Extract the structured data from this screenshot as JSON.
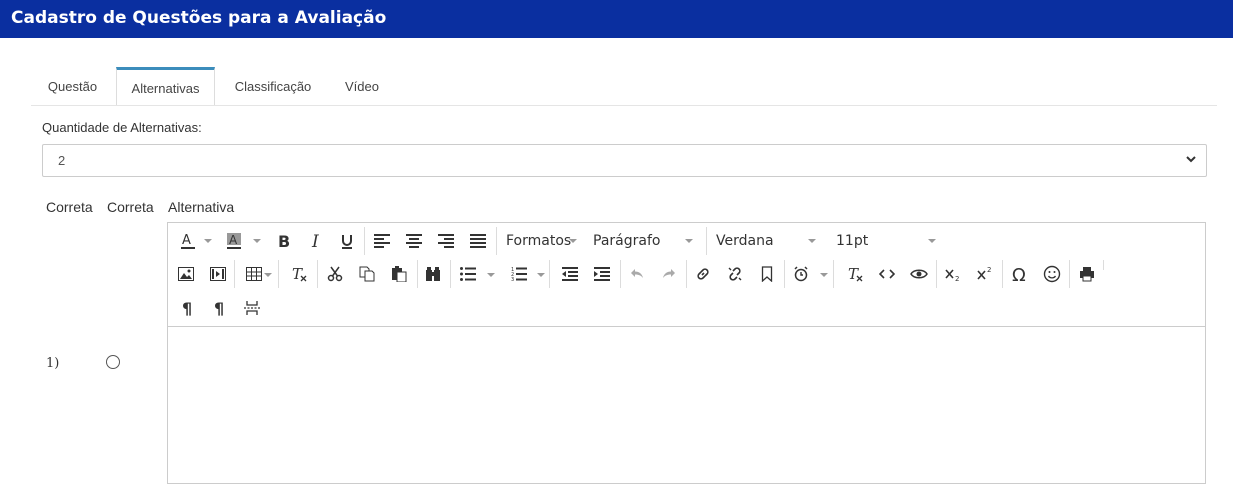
{
  "header": {
    "title": "Cadastro de Questões para a Avaliação"
  },
  "tabs": [
    {
      "label": "Questão",
      "active": false
    },
    {
      "label": "Alternativas",
      "active": true
    },
    {
      "label": "Classificação",
      "active": false
    },
    {
      "label": "Vídeo",
      "active": false
    }
  ],
  "quantity": {
    "label": "Quantidade de Alternativas:",
    "value": "2"
  },
  "columns": {
    "correta1": "Correta",
    "correta2": "Correta",
    "alternativa": "Alternativa"
  },
  "editor": {
    "formats_label": "Formatos",
    "block_label": "Parágrafo",
    "font_label": "Verdana",
    "size_label": "11pt"
  },
  "rows": [
    {
      "number": "1)"
    }
  ],
  "colors": {
    "header_bg": "#0a2fa0",
    "tab_accent": "#3c8dbc"
  }
}
